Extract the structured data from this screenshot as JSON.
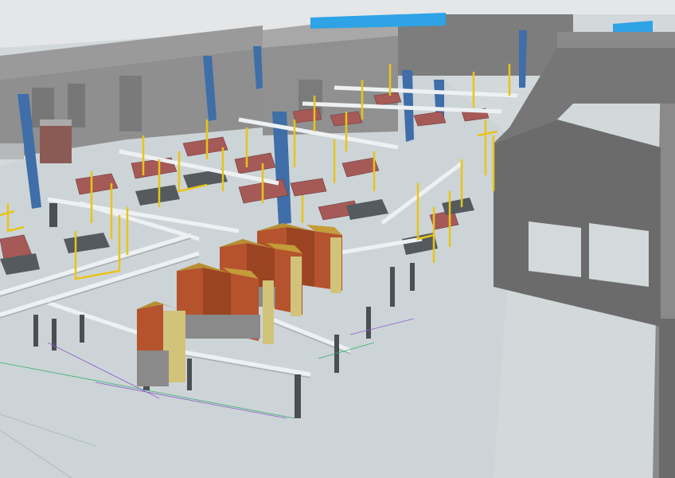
{
  "viewport": {
    "kind": "3d-cad-factory-layout",
    "colors": {
      "floor": "#cfd5d8",
      "wall": "#6b6b6b",
      "wall_light": "#a9a9a9",
      "column_blue": "#3f6ea8",
      "frame_yellow": "#e8c419",
      "bench_red": "#a55a58",
      "bench_dark": "#555a5e",
      "conveyor": "#e8ecef",
      "cabinet_orange": "#b5532e",
      "cabinet_gold": "#b58f34",
      "cabinet_grey": "#8a8a8a",
      "roof_blue": "#2ea3e6",
      "line_green": "#33b06a",
      "line_purple": "#8a5cc8"
    },
    "icons": [
      "factory-building",
      "steel-column",
      "workstation",
      "conveyor-line",
      "storage-cabinet",
      "roof-skylight"
    ]
  }
}
